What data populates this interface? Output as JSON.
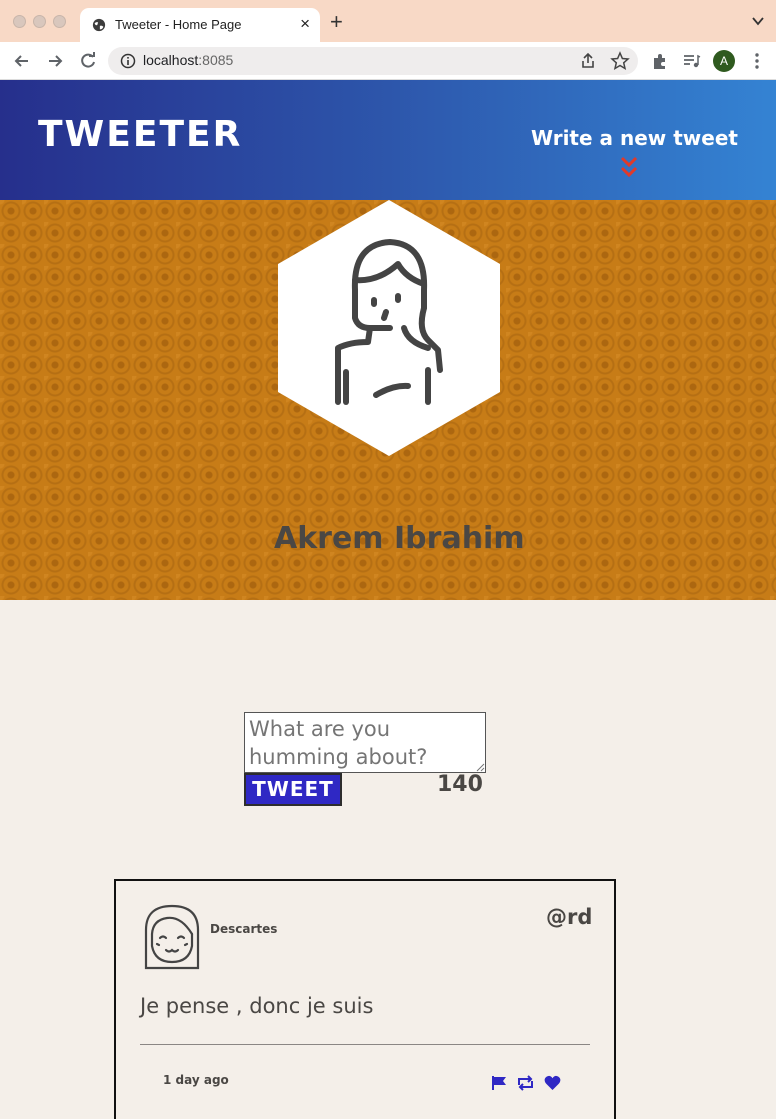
{
  "browser": {
    "tab_title": "Tweeter - Home Page",
    "tab_close": "×",
    "new_tab": "+",
    "url_host": "localhost",
    "url_port": ":8085",
    "profile_initial": "A"
  },
  "nav": {
    "brand": "TWEETER",
    "compose_label": "Write a new tweet"
  },
  "profile": {
    "name": "Akrem Ibrahim"
  },
  "composer": {
    "placeholder": "What are you humming about?",
    "button_label": "TWEET",
    "counter": "140"
  },
  "tweets": [
    {
      "name": "Descartes",
      "handle": "@rd",
      "text": "Je pense , donc je suis",
      "time": "1 day ago"
    }
  ],
  "colors": {
    "accent_blue": "#2f28c4",
    "nav_gradient_start": "#262f8c",
    "nav_gradient_end": "#3483d3",
    "header_gold": "#c77c17",
    "chevron_red": "#e03a2a",
    "page_bg": "#f4efe9",
    "text": "#4a4744"
  }
}
